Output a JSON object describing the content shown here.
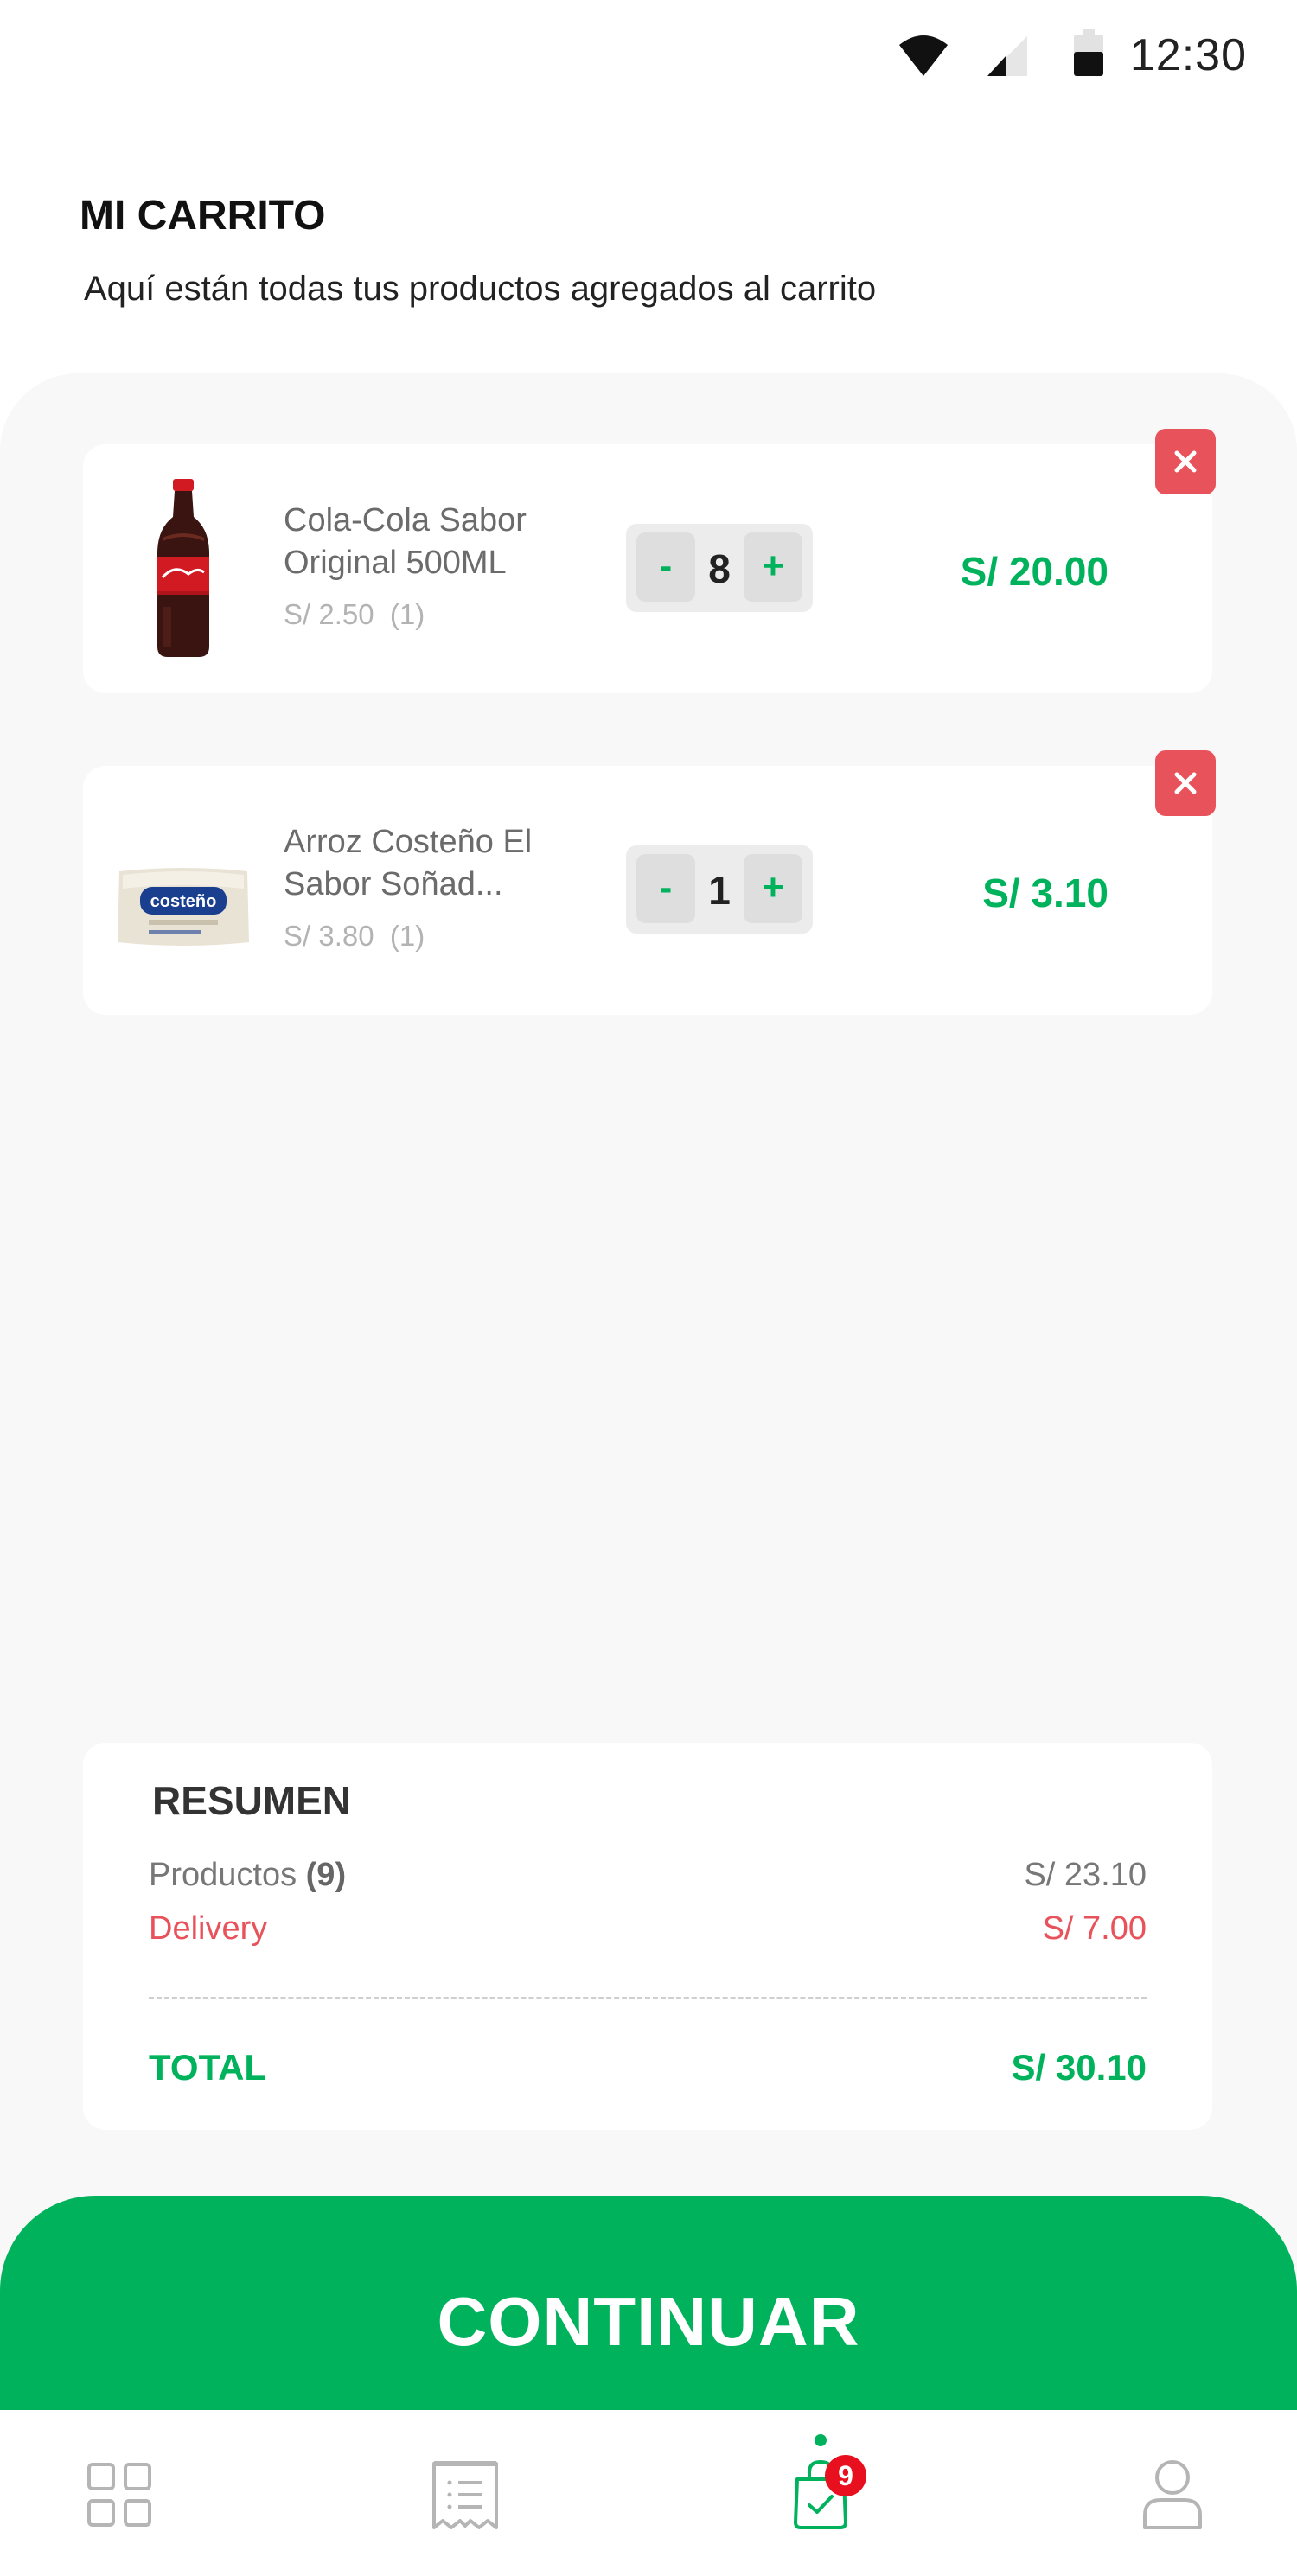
{
  "status_bar": {
    "time": "12:30"
  },
  "header": {
    "title": "MI CARRITO",
    "subtitle": "Aquí están todas tus productos agregados al carrito"
  },
  "cart": {
    "items": [
      {
        "name": "Cola-Cola Sabor Original 500ML",
        "unit_price": "S/ 2.50",
        "unit_count": "(1)",
        "quantity": "8",
        "total": "S/ 20.00",
        "minus_label": "-",
        "plus_label": "+",
        "remove_icon": "close-icon"
      },
      {
        "name": "Arroz Costeño El Sabor Soñad...",
        "unit_price": "S/ 3.80",
        "unit_count": "(1)",
        "quantity": "1",
        "total": "S/ 3.10",
        "minus_label": "-",
        "plus_label": "+",
        "remove_icon": "close-icon",
        "image_brand_text": "costeño"
      }
    ]
  },
  "summary": {
    "title": "RESUMEN",
    "products_label": "Productos",
    "products_count": "(9)",
    "products_value": "S/ 23.10",
    "delivery_label": "Delivery",
    "delivery_value": "S/ 7.00",
    "total_label": "TOTAL",
    "total_value": "S/ 30.10"
  },
  "continue_button": {
    "label": "CONTINUAR"
  },
  "bottom_nav": {
    "items": [
      {
        "icon": "grid-icon",
        "active": false
      },
      {
        "icon": "receipt-icon",
        "active": false
      },
      {
        "icon": "shopping-bag-icon",
        "active": true,
        "badge": "9"
      },
      {
        "icon": "user-icon",
        "active": false
      }
    ]
  },
  "colors": {
    "accent": "#00b25c",
    "danger": "#e8525a",
    "badge": "#e8101e",
    "panel_background": "#f8f8f8"
  }
}
